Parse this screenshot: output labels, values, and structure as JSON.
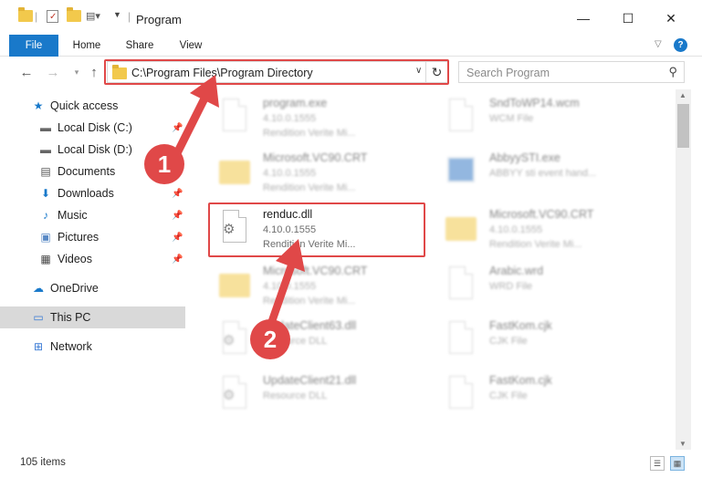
{
  "window": {
    "title": "Program",
    "minimize": "—",
    "maximize": "☐",
    "close": "✕"
  },
  "ribbon": {
    "tabs": [
      "File",
      "Home",
      "Share",
      "View"
    ],
    "help": "?"
  },
  "address_bar": {
    "path": "C:\\Program Files\\Program Directory",
    "search_placeholder": "Search Program"
  },
  "sidebar": {
    "items": [
      {
        "label": "Quick access",
        "icon": "star-icon"
      },
      {
        "label": "Local Disk (C:)",
        "icon": "drive-icon"
      },
      {
        "label": "Local Disk (D:)",
        "icon": "drive-icon"
      },
      {
        "label": "Documents",
        "icon": "documents-icon"
      },
      {
        "label": "Downloads",
        "icon": "download-icon"
      },
      {
        "label": "Music",
        "icon": "music-icon"
      },
      {
        "label": "Pictures",
        "icon": "pictures-icon"
      },
      {
        "label": "Videos",
        "icon": "videos-icon"
      },
      {
        "label": "OneDrive",
        "icon": "cloud-icon"
      },
      {
        "label": "This PC",
        "icon": "computer-icon"
      },
      {
        "label": "Network",
        "icon": "network-icon"
      }
    ]
  },
  "files": [
    {
      "name": "program.exe",
      "line2": "4.10.0.1555",
      "line3": "Rendition Verite Mi..."
    },
    {
      "name": "SndToWP14.wcm",
      "line2": "WCM File",
      "line3": ""
    },
    {
      "name": "Microsoft.VC90.CRT",
      "line2": "4.10.0.1555",
      "line3": "Rendition Verite Mi..."
    },
    {
      "name": "AbbyySTI.exe",
      "line2": "ABBYY sti event hand...",
      "line3": ""
    },
    {
      "name": "renduc.dll",
      "line2": "4.10.0.1555",
      "line3": "Rendition Verite Mi..."
    },
    {
      "name": "Microsoft.VC90.CRT",
      "line2": "4.10.0.1555",
      "line3": "Rendition Verite Mi..."
    },
    {
      "name": "Microsoft.VC90.CRT",
      "line2": "4.10.0.1555",
      "line3": "Rendition Verite Mi..."
    },
    {
      "name": "Arabic.wrd",
      "line2": "WRD File",
      "line3": ""
    },
    {
      "name": "UpdateClient63.dll",
      "line2": "Resource DLL",
      "line3": ""
    },
    {
      "name": "FastKom.cjk",
      "line2": "CJK File",
      "line3": ""
    },
    {
      "name": "UpdateClient21.dll",
      "line2": "Resource DLL",
      "line3": ""
    },
    {
      "name": "FastKom.cjk",
      "line2": "CJK File",
      "line3": ""
    }
  ],
  "status_bar": {
    "item_count": "105 items"
  },
  "annotations": {
    "callout_1": "1",
    "callout_2": "2",
    "highlight_color": "#e04848"
  },
  "colors": {
    "file_tab": "#1979ca",
    "selected_nav": "#d9d9d9"
  }
}
